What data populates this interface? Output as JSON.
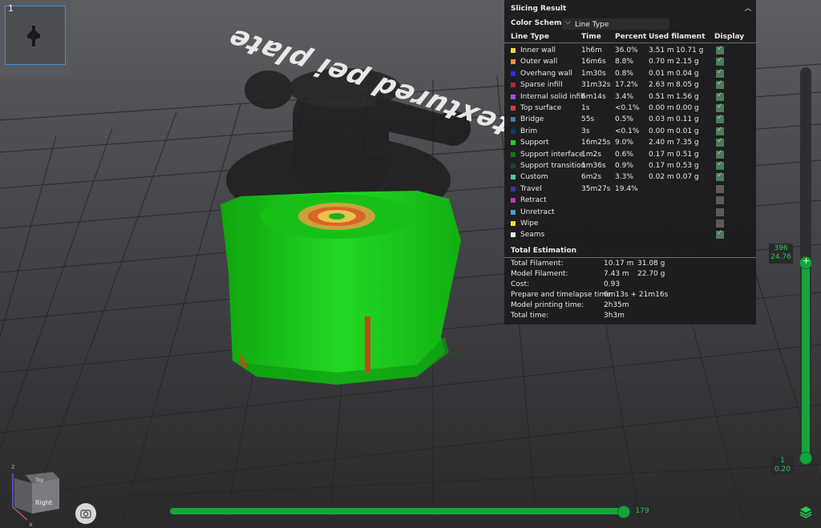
{
  "thumbnail": {
    "number": "1"
  },
  "plate_text": "textured pei plate",
  "panel": {
    "title": "Slicing Result",
    "color_scheme_label": "Color Scheme",
    "color_scheme_value": "Line Type",
    "headers": {
      "line_type": "Line Type",
      "time": "Time",
      "percent": "Percent",
      "used_filament": "Used filament",
      "display": "Display"
    },
    "rows": [
      {
        "name": "Inner wall",
        "color": "#f5d742",
        "time": "1h6m",
        "percent": "36.0%",
        "m": "3.51 m",
        "g": "10.71 g",
        "display": true
      },
      {
        "name": "Outer wall",
        "color": "#f28c3a",
        "time": "16m6s",
        "percent": "8.8%",
        "m": "0.70 m",
        "g": "2.15 g",
        "display": true
      },
      {
        "name": "Overhang wall",
        "color": "#2b2bf0",
        "time": "1m30s",
        "percent": "0.8%",
        "m": "0.01 m",
        "g": "0.04 g",
        "display": true
      },
      {
        "name": "Sparse infill",
        "color": "#b02a2a",
        "time": "31m32s",
        "percent": "17.2%",
        "m": "2.63 m",
        "g": "8.05 g",
        "display": true
      },
      {
        "name": "Internal solid infill",
        "color": "#a052d1",
        "time": "6m14s",
        "percent": "3.4%",
        "m": "0.51 m",
        "g": "1.56 g",
        "display": true
      },
      {
        "name": "Top surface",
        "color": "#e03a3a",
        "time": "1s",
        "percent": "<0.1%",
        "m": "0.00 m",
        "g": "0.00 g",
        "display": true
      },
      {
        "name": "Bridge",
        "color": "#4a7ab8",
        "time": "55s",
        "percent": "0.5%",
        "m": "0.03 m",
        "g": "0.11 g",
        "display": true
      },
      {
        "name": "Brim",
        "color": "#0d3a6b",
        "time": "3s",
        "percent": "<0.1%",
        "m": "0.00 m",
        "g": "0.01 g",
        "display": true
      },
      {
        "name": "Support",
        "color": "#1ed01e",
        "time": "16m25s",
        "percent": "9.0%",
        "m": "2.40 m",
        "g": "7.35 g",
        "display": true
      },
      {
        "name": "Support interface",
        "color": "#0f7a10",
        "time": "1m2s",
        "percent": "0.6%",
        "m": "0.17 m",
        "g": "0.51 g",
        "display": true
      },
      {
        "name": "Support transition",
        "color": "#124d1a",
        "time": "1m36s",
        "percent": "0.9%",
        "m": "0.17 m",
        "g": "0.53 g",
        "display": true
      },
      {
        "name": "Custom",
        "color": "#4fc99a",
        "time": "6m2s",
        "percent": "3.3%",
        "m": "0.02 m",
        "g": "0.07 g",
        "display": true
      },
      {
        "name": "Travel",
        "color": "#2a3d9a",
        "time": "35m27s",
        "percent": "19.4%",
        "m": "",
        "g": "",
        "display": false
      },
      {
        "name": "Retract",
        "color": "#c52fc5",
        "time": "",
        "percent": "",
        "m": "",
        "g": "",
        "display": false
      },
      {
        "name": "Unretract",
        "color": "#3fa3d8",
        "time": "",
        "percent": "",
        "m": "",
        "g": "",
        "display": false
      },
      {
        "name": "Wipe",
        "color": "#f2e51a",
        "time": "",
        "percent": "",
        "m": "",
        "g": "",
        "display": false
      },
      {
        "name": "Seams",
        "color": "#e8e8e8",
        "time": "",
        "percent": "",
        "m": "",
        "g": "",
        "display": true
      }
    ],
    "total_title": "Total Estimation",
    "totals": [
      {
        "label": "Total Filament:",
        "v1": "10.17 m",
        "v2": "31.08 g"
      },
      {
        "label": "Model Filament:",
        "v1": "7.43 m",
        "v2": "22.70 g"
      },
      {
        "label": "Cost:",
        "v1": "0.93",
        "v2": ""
      },
      {
        "label": "Prepare and timelapse time:",
        "v1": "6m13s + 21m16s",
        "v2": ""
      },
      {
        "label": "Model printing time:",
        "v1": "2h35m",
        "v2": ""
      },
      {
        "label": "Total time:",
        "v1": "3h3m",
        "v2": ""
      }
    ]
  },
  "vslider": {
    "top_layer": "396",
    "top_height": "24.76",
    "bottom_layer": "1",
    "bottom_height": "0.20"
  },
  "hslider": {
    "value": "179"
  },
  "axis": {
    "right_label": "Right",
    "top_label": "Top",
    "z": "z",
    "x": "x"
  }
}
